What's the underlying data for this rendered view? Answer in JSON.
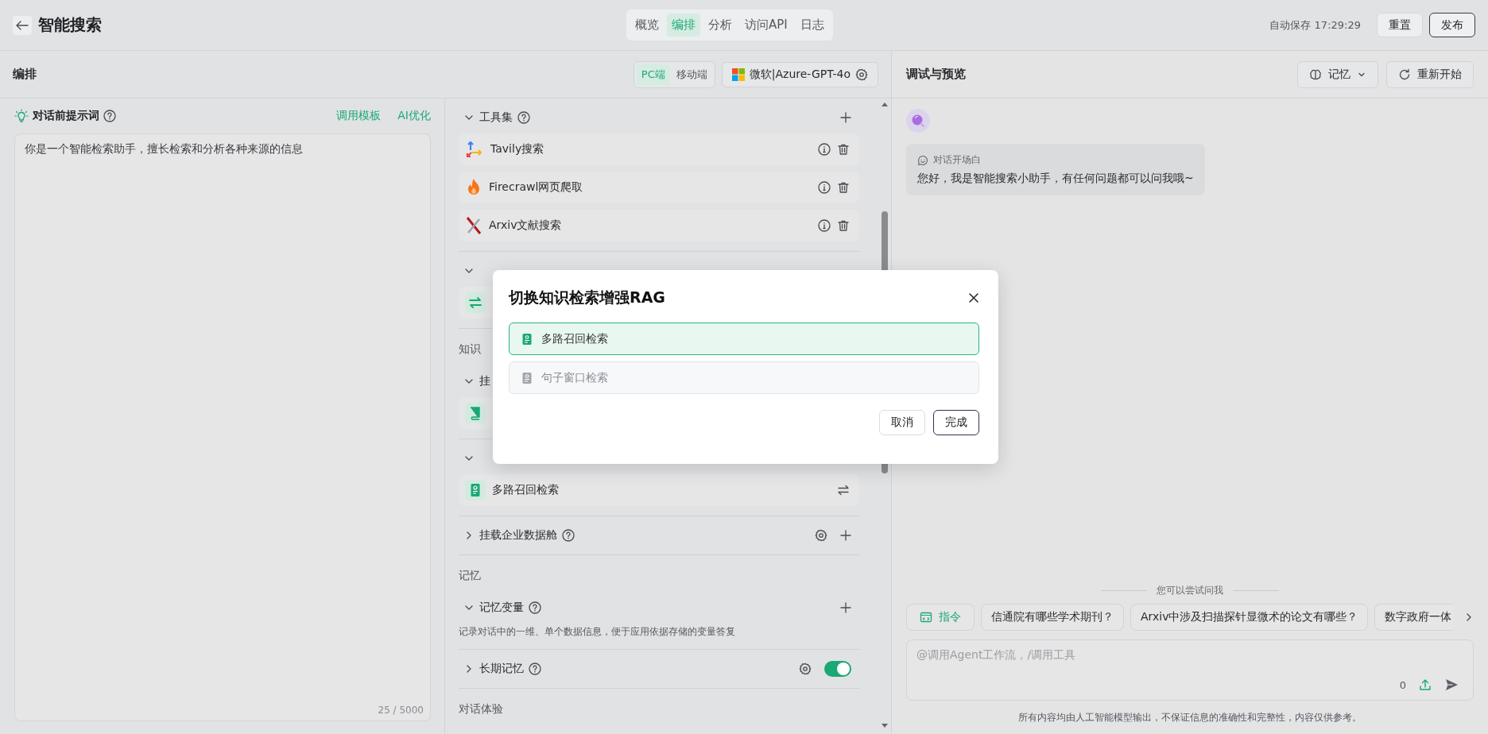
{
  "topbar": {
    "title": "智能搜索",
    "tabs": [
      {
        "label": "概览",
        "selected": false
      },
      {
        "label": "编排",
        "selected": true
      },
      {
        "label": "分析",
        "selected": false
      },
      {
        "label": "访问API",
        "selected": false
      },
      {
        "label": "日志",
        "selected": false
      }
    ],
    "autosave": "自动保存 17:29:29",
    "buttons": [
      {
        "label": "重置",
        "kind": "secondary"
      },
      {
        "label": "发布",
        "kind": "outline"
      }
    ]
  },
  "editor": {
    "title": "编排",
    "device_tabs": [
      {
        "label": "PC端",
        "selected": true
      },
      {
        "label": "移动端",
        "selected": false
      }
    ],
    "model": "微软|Azure-GPT-4o"
  },
  "prompt": {
    "title": "对话前提示词",
    "links": [
      "调用模板",
      "AI优化"
    ],
    "value": "你是一个智能检索助手，擅长检索和分析各种来源的信息",
    "counter": "25 / 5000"
  },
  "config": [
    {
      "kind": "group",
      "title": "工具集",
      "expanded": true,
      "help": true,
      "actions": [
        {
          "kind": "add"
        }
      ],
      "items": [
        {
          "kind": "tavily",
          "name": "Tavily搜索"
        },
        {
          "kind": "firecrawl",
          "name": "Firecrawl网页爬取"
        },
        {
          "kind": "arxiv",
          "name": "Arxiv文献搜索"
        }
      ]
    },
    {
      "kind": "group",
      "expanded": true,
      "help": false,
      "items": [
        {
          "kind": "workflow"
        }
      ]
    },
    {
      "kind": "label",
      "title": "知识"
    },
    {
      "kind": "group",
      "title": "挂",
      "expanded": true,
      "help": false,
      "items": [
        {
          "kind": "book"
        }
      ]
    },
    {
      "kind": "group",
      "expanded": true,
      "help": false,
      "items": [
        {
          "kind": "rag",
          "name": "多路召回检索"
        }
      ]
    },
    {
      "kind": "group",
      "title": "挂载企业数据舱",
      "expanded": false,
      "help": true,
      "actions": [
        {
          "kind": "gear"
        },
        {
          "kind": "add"
        }
      ]
    },
    {
      "kind": "label",
      "title": "记忆"
    },
    {
      "kind": "group",
      "title": "记忆变量",
      "expanded": true,
      "help": true,
      "actions": [
        {
          "kind": "add"
        }
      ],
      "description": "记录对话中的一维、单个数据信息，便于应用依据存储的变量答复"
    },
    {
      "kind": "group",
      "title": "长期记忆",
      "expanded": false,
      "help": true,
      "actions": [
        {
          "kind": "gear"
        },
        {
          "kind": "toggle",
          "on": true
        }
      ]
    },
    {
      "kind": "label",
      "title": "对话体验"
    }
  ],
  "preview": {
    "title": "调试与预览",
    "buttons": [
      {
        "label": "记忆",
        "kind": "dropdown"
      },
      {
        "label": "重新开始",
        "kind": "restart"
      }
    ],
    "opener": {
      "label": "对话开场白",
      "text": "您好，我是智能搜索小助手，有任何问题都可以问我哦~"
    },
    "suggest_label": "您可以尝试问我",
    "chips": [
      {
        "label": "指令",
        "kind": "command"
      },
      {
        "label": "信通院有哪些学术期刊？",
        "kind": "question"
      },
      {
        "label": "Arxiv中涉及扫描探针显微术的论文有哪些？",
        "kind": "question"
      },
      {
        "label": "数字政府一体",
        "kind": "question"
      }
    ],
    "input": {
      "placeholder": "@调用Agent工作流，/调用工具",
      "count": "0"
    },
    "disclaimer": "所有内容均由人工智能模型输出，不保证信息的准确性和完整性，内容仅供参考。"
  },
  "modal": {
    "title": "切换知识检索增强RAG",
    "options": [
      {
        "label": "多路召回检索",
        "selected": true
      },
      {
        "label": "句子窗口检索",
        "selected": false
      }
    ],
    "buttons": [
      {
        "label": "取消",
        "kind": "plain"
      },
      {
        "label": "完成",
        "kind": "primary"
      }
    ]
  }
}
